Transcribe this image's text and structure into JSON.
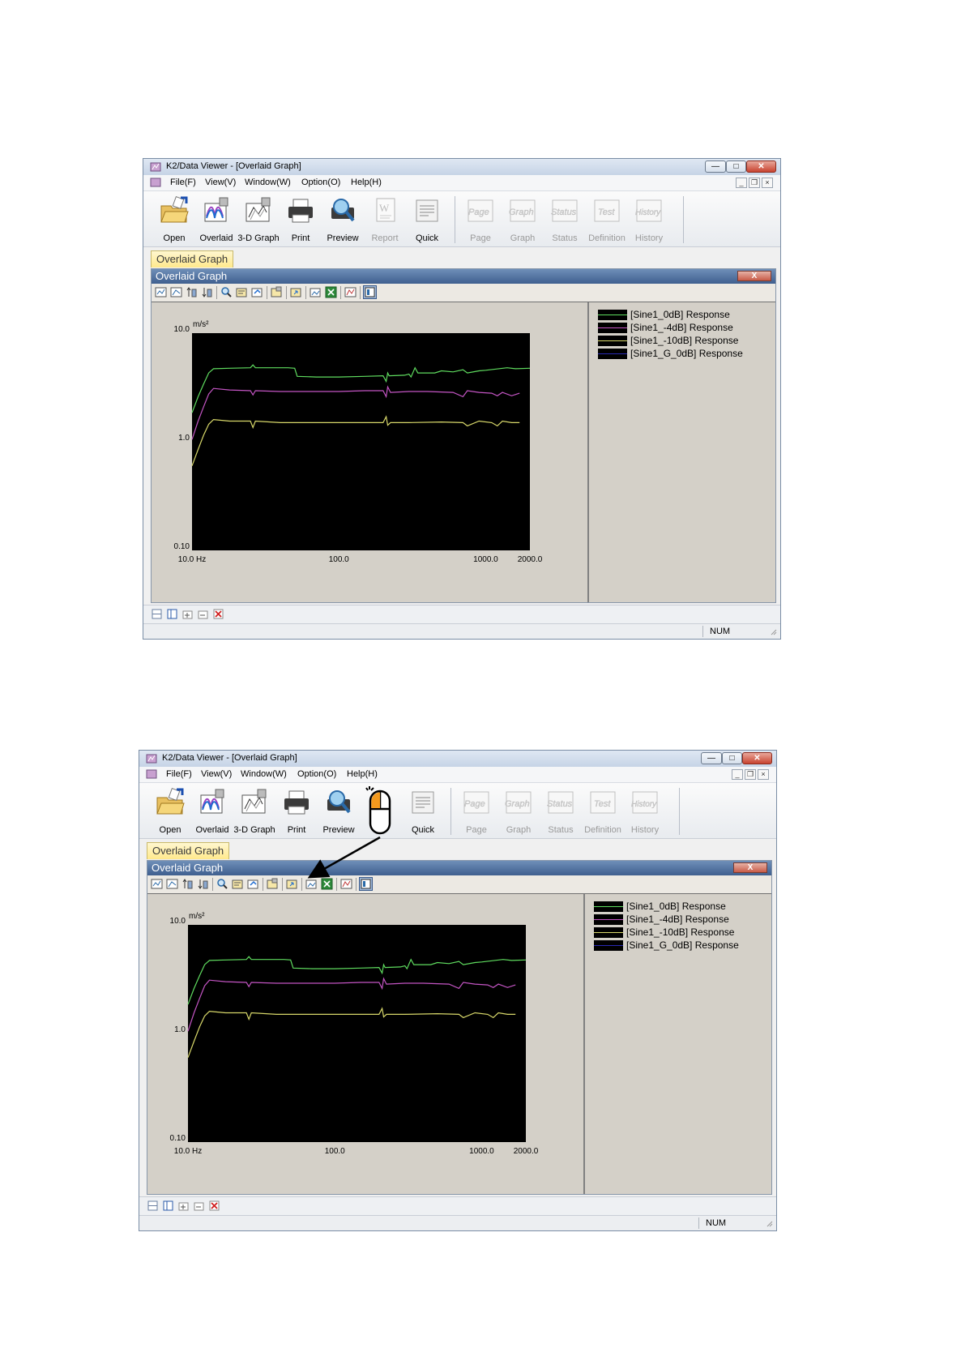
{
  "app": {
    "window_title": "K2/Data Viewer - [Overlaid Graph]",
    "menus": [
      "File(F)",
      "View(V)",
      "Window(W)",
      "Option(O)",
      "Help(H)"
    ],
    "toolbar_buttons": [
      {
        "label": "Open",
        "icon": "open-folder-icon",
        "enabled": true
      },
      {
        "label": "Overlaid",
        "icon": "overlaid-graph-icon",
        "enabled": true
      },
      {
        "label": "3-D Graph",
        "icon": "3d-graph-icon",
        "enabled": true
      },
      {
        "label": "Print",
        "icon": "printer-icon",
        "enabled": true
      },
      {
        "label": "Preview",
        "icon": "preview-magnifier-icon",
        "enabled": true
      },
      {
        "label": "Report",
        "icon": "word-report-icon",
        "enabled": false
      },
      {
        "label": "Quick",
        "icon": "quick-print-icon",
        "enabled": true
      },
      {
        "label": "Page",
        "icon": "page-icon",
        "enabled": false
      },
      {
        "label": "Graph",
        "icon": "graph-icon",
        "enabled": false
      },
      {
        "label": "Status",
        "icon": "status-icon",
        "enabled": false
      },
      {
        "label": "Definition",
        "icon": "test-definition-icon",
        "enabled": false
      },
      {
        "label": "History",
        "icon": "history-icon",
        "enabled": false
      }
    ],
    "toolbar_icon_captions": {
      "page": "Page",
      "graph": "Graph",
      "status": "Status",
      "definition": "Test",
      "history": "History"
    },
    "doc_tab": "Overlaid Graph",
    "child_window_title": "Overlaid Graph",
    "child_close_glyph": "X",
    "status_num": "NUM",
    "callout_note": "Second screenshot: the Report button is covered by a mouse (left-click) icon whose arrow points to a button in the graph window toolbar."
  },
  "chart_data": {
    "type": "line",
    "x_scale": "log",
    "y_scale": "log",
    "xlim": [
      10,
      2000
    ],
    "ylim": [
      0.1,
      10
    ],
    "x_ticks": [
      "10.0 Hz",
      "100.0",
      "1000.0",
      "2000.0"
    ],
    "y_ticks": [
      "10.0",
      "1.0",
      "0.10"
    ],
    "y_unit": "m/s²",
    "background": "#000000",
    "series": [
      {
        "name": "[Sine1_0dB] Response",
        "color": "#5fdc5f",
        "points": [
          [
            10,
            1.85
          ],
          [
            11,
            2.6
          ],
          [
            12,
            3.4
          ],
          [
            13,
            4.3
          ],
          [
            14,
            4.7
          ],
          [
            18,
            4.75
          ],
          [
            25,
            4.8
          ],
          [
            26,
            5.1
          ],
          [
            27,
            4.8
          ],
          [
            45,
            4.8
          ],
          [
            50,
            4.75
          ],
          [
            52,
            4.0
          ],
          [
            70,
            3.95
          ],
          [
            100,
            3.95
          ],
          [
            150,
            4.0
          ],
          [
            200,
            4.05
          ],
          [
            210,
            3.6
          ],
          [
            215,
            4.3
          ],
          [
            220,
            4.05
          ],
          [
            280,
            4.1
          ],
          [
            300,
            4.2
          ],
          [
            310,
            3.95
          ],
          [
            330,
            4.8
          ],
          [
            345,
            4.3
          ],
          [
            450,
            4.3
          ],
          [
            500,
            4.5
          ],
          [
            600,
            4.4
          ],
          [
            700,
            4.6
          ],
          [
            750,
            4.3
          ],
          [
            900,
            4.5
          ],
          [
            1000,
            4.55
          ],
          [
            1400,
            4.8
          ],
          [
            1600,
            4.7
          ],
          [
            2000,
            4.75
          ]
        ]
      },
      {
        "name": "[Sine1_-4dB] Response",
        "color": "#c455c4",
        "points": [
          [
            10,
            1.05
          ],
          [
            11,
            1.55
          ],
          [
            12,
            2.1
          ],
          [
            13,
            2.75
          ],
          [
            14,
            3.1
          ],
          [
            18,
            3.0
          ],
          [
            25,
            2.95
          ],
          [
            26,
            2.7
          ],
          [
            27,
            2.95
          ],
          [
            40,
            2.9
          ],
          [
            70,
            2.9
          ],
          [
            100,
            2.9
          ],
          [
            150,
            2.95
          ],
          [
            200,
            2.95
          ],
          [
            210,
            2.6
          ],
          [
            215,
            3.2
          ],
          [
            225,
            2.85
          ],
          [
            300,
            2.9
          ],
          [
            400,
            2.9
          ],
          [
            600,
            2.85
          ],
          [
            700,
            2.6
          ],
          [
            750,
            2.95
          ],
          [
            900,
            2.85
          ],
          [
            1100,
            2.8
          ],
          [
            1200,
            2.65
          ],
          [
            1300,
            2.85
          ],
          [
            1500,
            2.65
          ],
          [
            1700,
            2.8
          ]
        ]
      },
      {
        "name": "[Sine1_-10dB] Response",
        "color": "#d8d86a",
        "points": [
          [
            10,
            0.6
          ],
          [
            11,
            0.85
          ],
          [
            12,
            1.15
          ],
          [
            13,
            1.45
          ],
          [
            14,
            1.6
          ],
          [
            18,
            1.55
          ],
          [
            25,
            1.55
          ],
          [
            26,
            1.35
          ],
          [
            27,
            1.55
          ],
          [
            40,
            1.5
          ],
          [
            70,
            1.5
          ],
          [
            100,
            1.5
          ],
          [
            150,
            1.5
          ],
          [
            200,
            1.5
          ],
          [
            210,
            1.7
          ],
          [
            215,
            1.42
          ],
          [
            225,
            1.5
          ],
          [
            300,
            1.5
          ],
          [
            500,
            1.52
          ],
          [
            700,
            1.5
          ],
          [
            750,
            1.4
          ],
          [
            900,
            1.55
          ],
          [
            1100,
            1.5
          ],
          [
            1200,
            1.4
          ],
          [
            1300,
            1.55
          ],
          [
            1500,
            1.5
          ],
          [
            1700,
            1.5
          ]
        ]
      },
      {
        "name": "[Sine1_G_0dB] Response",
        "color": "#2a2ab4",
        "points": []
      }
    ]
  }
}
